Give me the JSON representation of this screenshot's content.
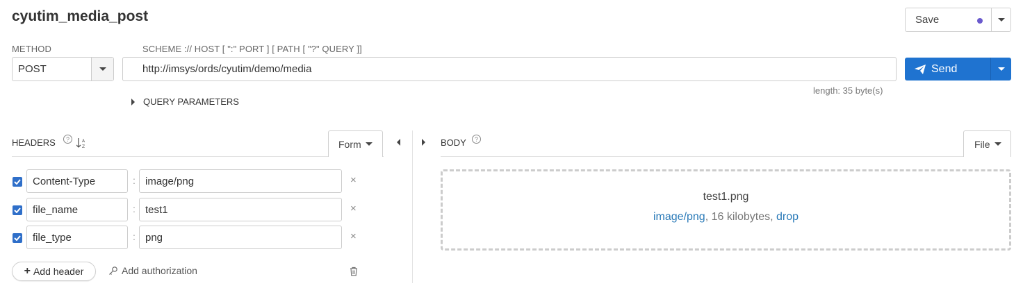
{
  "request": {
    "title": "cyutim_media_post",
    "save_label": "Save",
    "method_label": "METHOD",
    "method_value": "POST",
    "url_label": "SCHEME :// HOST [ \":\" PORT ] [ PATH [ \"?\" QUERY ]]",
    "url_value": "http://imsys/ords/cyutim/demo/media",
    "url_length": "length: 35 byte(s)",
    "send_label": "Send",
    "query_params_label": "QUERY PARAMETERS"
  },
  "headers": {
    "label": "HEADERS",
    "mode_label": "Form",
    "rows": [
      {
        "name": "Content-Type",
        "value": "image/png"
      },
      {
        "name": "file_name",
        "value": "test1"
      },
      {
        "name": "file_type",
        "value": "png"
      }
    ],
    "add_header_label": "Add header",
    "add_auth_label": "Add authorization"
  },
  "body": {
    "label": "BODY",
    "mode_label": "File",
    "file_name": "test1.png",
    "file_type": "image/png",
    "file_size": "16 kilobytes",
    "drop_label": "drop"
  },
  "colors": {
    "accent": "#1f73d0",
    "save_dot": "#6a5acd",
    "link": "#2a7ab8"
  }
}
